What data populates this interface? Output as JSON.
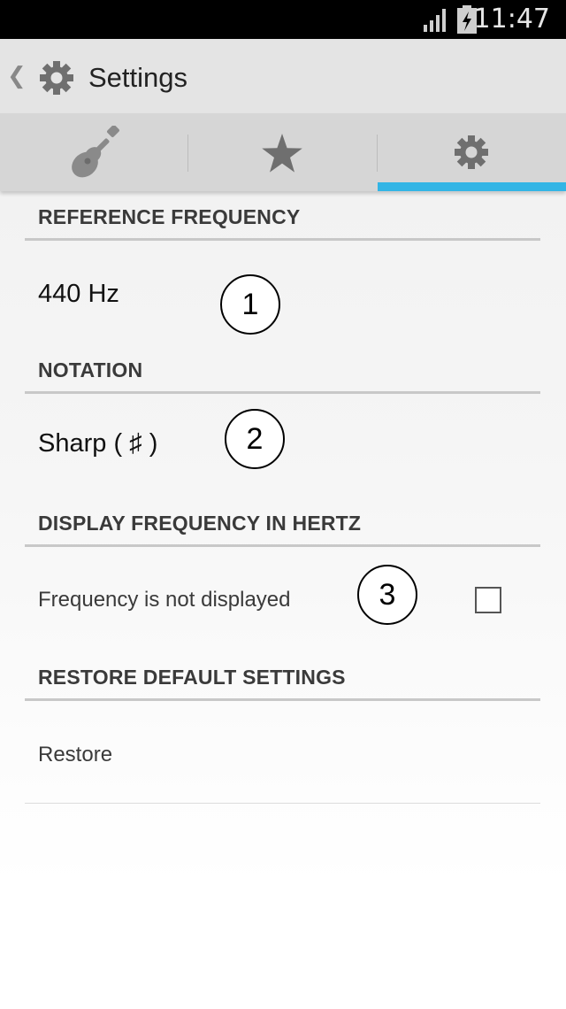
{
  "status_bar": {
    "time": "11:47"
  },
  "action_bar": {
    "title": "Settings"
  },
  "tabs": [
    {
      "icon": "guitar-icon"
    },
    {
      "icon": "star-icon"
    },
    {
      "icon": "gear-icon",
      "selected": true
    }
  ],
  "sections": {
    "reference_frequency": {
      "header": "REFERENCE FREQUENCY",
      "value": "440 Hz",
      "annotation": "1"
    },
    "notation": {
      "header": "NOTATION",
      "value": "Sharp ( ♯ )",
      "annotation": "2"
    },
    "display_frequency": {
      "header": "DISPLAY FREQUENCY IN HERTZ",
      "value": "Frequency is not displayed",
      "annotation": "3",
      "checked": false
    },
    "restore": {
      "header": "RESTORE DEFAULT SETTINGS",
      "value": "Restore"
    }
  },
  "colors": {
    "accent": "#33b5e5",
    "action_bar": "#e4e4e4",
    "tab_bar": "#d6d6d6",
    "icon_gray": "#6f6f6f"
  }
}
